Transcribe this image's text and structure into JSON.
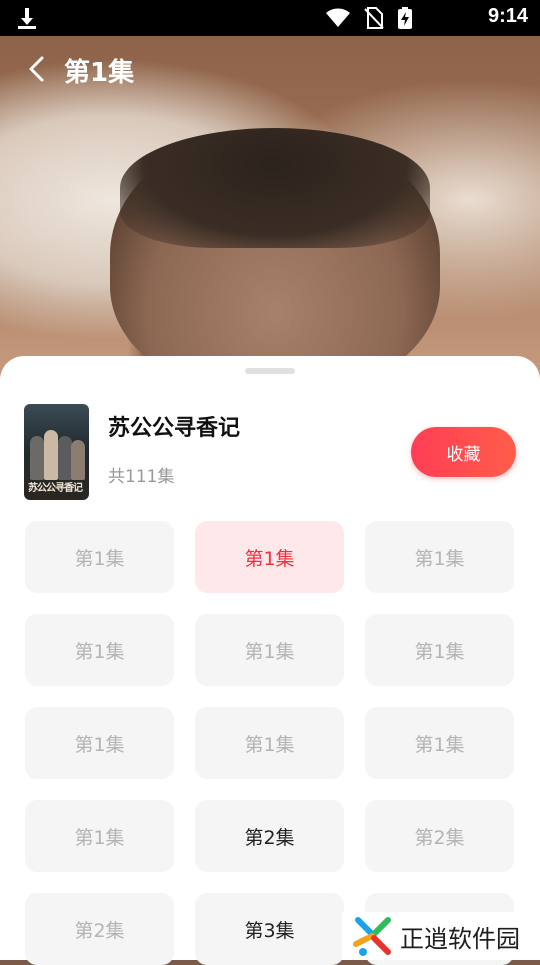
{
  "status_bar": {
    "time": "9:14"
  },
  "header": {
    "title": "第1集"
  },
  "show": {
    "title": "苏公公寻香记",
    "episode_count": "共111集",
    "poster_text": "苏公公寻香记",
    "favorite_label": "收藏"
  },
  "episodes": [
    {
      "label": "第1集",
      "state": "normal"
    },
    {
      "label": "第1集",
      "state": "active"
    },
    {
      "label": "第1集",
      "state": "normal"
    },
    {
      "label": "第1集",
      "state": "normal"
    },
    {
      "label": "第1集",
      "state": "normal"
    },
    {
      "label": "第1集",
      "state": "normal"
    },
    {
      "label": "第1集",
      "state": "normal"
    },
    {
      "label": "第1集",
      "state": "normal"
    },
    {
      "label": "第1集",
      "state": "normal"
    },
    {
      "label": "第1集",
      "state": "normal"
    },
    {
      "label": "第2集",
      "state": "dark"
    },
    {
      "label": "第2集",
      "state": "normal"
    },
    {
      "label": "第2集",
      "state": "normal"
    },
    {
      "label": "第3集",
      "state": "dark"
    },
    {
      "label": "",
      "state": "normal"
    }
  ],
  "watermark": {
    "text": "正逍软件园"
  },
  "colors": {
    "accent": "#ff3d55",
    "active_bg": "#ffe8ea",
    "active_text": "#f0303e"
  }
}
